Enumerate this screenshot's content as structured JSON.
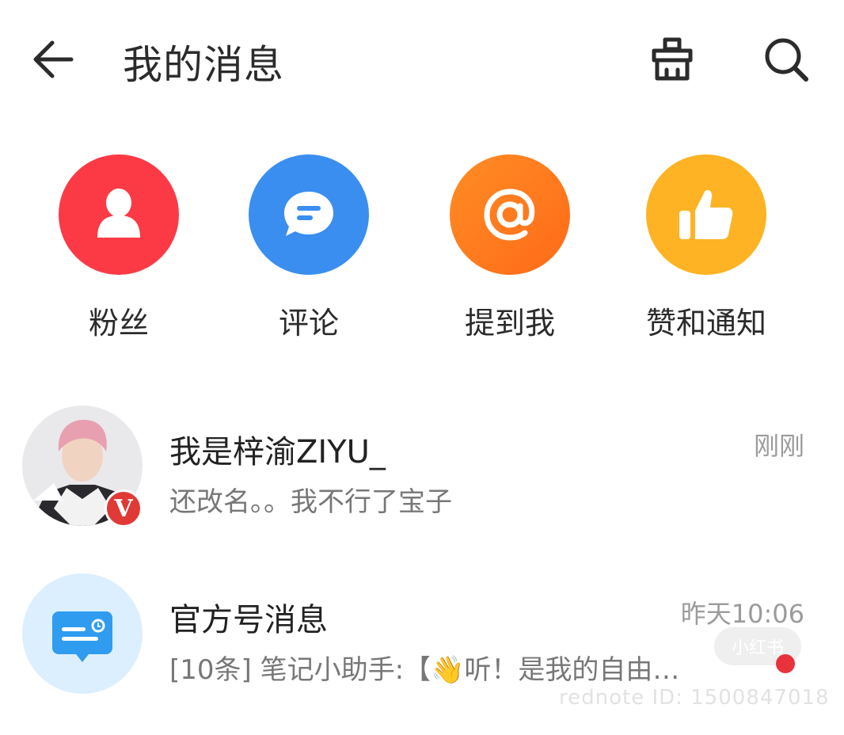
{
  "header": {
    "title": "我的消息",
    "back_icon": "arrow-left-icon",
    "clean_icon": "broom-icon",
    "search_icon": "search-icon"
  },
  "quick_actions": [
    {
      "label": "粉丝",
      "icon": "person-icon",
      "color": "#fb3a45"
    },
    {
      "label": "评论",
      "icon": "chat-bubble-icon",
      "color": "#3a8ef0"
    },
    {
      "label": "提到我",
      "icon": "at-sign-icon",
      "color": "#ff7a1c"
    },
    {
      "label": "赞和通知",
      "icon": "thumbs-up-icon",
      "color": "#fdb323"
    }
  ],
  "messages": [
    {
      "name": "我是梓渝ZIYU_",
      "preview": "还改名。。我不行了宝子",
      "time": "刚刚",
      "badge": "V"
    },
    {
      "name": "官方号消息",
      "preview": "[10条] 笔记小助手:【👋听！是我的自由…",
      "time": "昨天10:06",
      "icon": "official-message-icon"
    }
  ],
  "watermark": {
    "logo": "小红书",
    "text": "rednote ID: 1500847018"
  }
}
